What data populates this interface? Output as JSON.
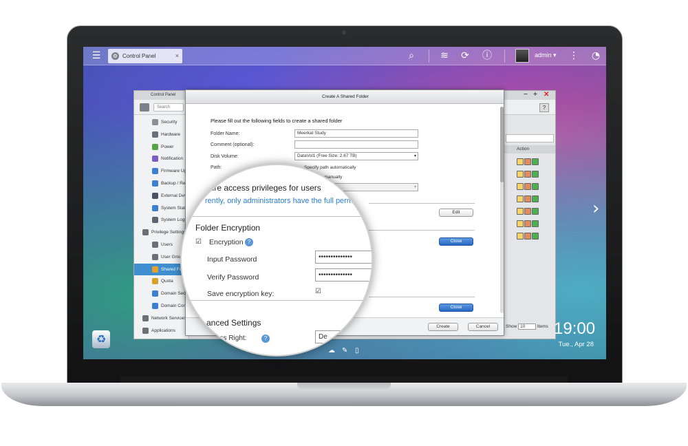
{
  "taskbar": {
    "tab_label": "Control Panel",
    "tab_close": "×",
    "user": "admin ▾",
    "icons": [
      "menu-icon",
      "search-icon",
      "stack-icon",
      "sync-icon",
      "info-icon",
      "more-icon",
      "dashboard-icon"
    ]
  },
  "control_panel": {
    "title": "Control Panel",
    "search_placeholder": "Search",
    "help": "?",
    "window_controls": [
      "−",
      "+",
      "✕"
    ],
    "sidebar": [
      {
        "label": "Security",
        "color": "#8a8f96"
      },
      {
        "label": "Hardware",
        "color": "#6a7079"
      },
      {
        "label": "Power",
        "color": "#58a34a"
      },
      {
        "label": "Notification",
        "color": "#7b5cc4"
      },
      {
        "label": "Firmware Update",
        "color": "#3b7fd3"
      },
      {
        "label": "Backup / Restore",
        "color": "#3b7fd3"
      },
      {
        "label": "External Device",
        "color": "#4a5360"
      },
      {
        "label": "System Status",
        "color": "#3b7fd3"
      },
      {
        "label": "System Logs",
        "color": "#5b6570"
      },
      {
        "label": "Privilege Settings",
        "color": "#6b6f76"
      },
      {
        "label": "Users",
        "color": "#6b6f76"
      },
      {
        "label": "User Groups",
        "color": "#6b6f76"
      },
      {
        "label": "Shared Folders",
        "color": "#e4a22a"
      },
      {
        "label": "Quota",
        "color": "#d9a028"
      },
      {
        "label": "Domain Security",
        "color": "#3b7fd3"
      },
      {
        "label": "Domain Controller",
        "color": "#3b7fd3"
      },
      {
        "label": "Network Services",
        "color": "#6b6f76"
      },
      {
        "label": "Applications",
        "color": "#6b6f76"
      }
    ],
    "action_header": "Action",
    "show_label": "Show",
    "show_value": "10",
    "items_label": "Items"
  },
  "dialog": {
    "title": "Create A Shared Folder",
    "intro": "Please fill out the following fields to create a shared folder",
    "folder_name_label": "Folder Name:",
    "folder_name_value": "Meerkat Study",
    "comment_label": "Comment (optional):",
    "comment_value": "",
    "disk_volume_label": "Disk Volume:",
    "disk_volume_value": "DataVol1 (Free Size: 2.67 TB)",
    "path_label": "Path:",
    "path_auto": "Specify path automatically",
    "path_manual": "h manually",
    "edit_button": "Edit",
    "close_button": "Close",
    "close_button_2": "Close",
    "create_button": "Create",
    "cancel_button": "Cancel"
  },
  "magnifier": {
    "access_heading": "gure access privileges for users",
    "access_note": "rently, only administrators have the full perm",
    "encryption_heading": "Folder Encryption",
    "encryption_label": "Encryption",
    "encryption_checked": true,
    "input_password_label": "Input Password",
    "input_password_value": "••••••••••••••",
    "verify_password_label": "Verify Password",
    "verify_password_value": "••••••••••••••",
    "save_key_label": "Save encryption key:",
    "save_key_checked": true,
    "advanced_heading": "anced Settings",
    "access_right_label": "ccess Right:",
    "access_right_value": "De"
  },
  "desktop": {
    "time": "19:00",
    "date": "Tue., Apr 28"
  }
}
